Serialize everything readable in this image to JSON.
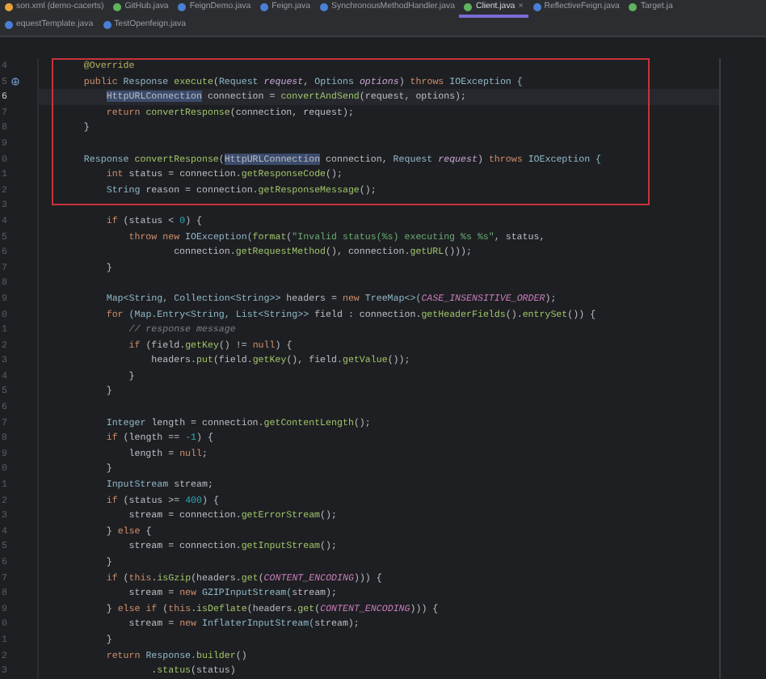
{
  "tabs_row_1": [
    {
      "label": "son.xml (demo-cacerts)",
      "color": "#e8a33c",
      "selected": false
    },
    {
      "label": "GitHub.java",
      "color": "#5fb35f",
      "selected": false
    },
    {
      "label": "FeignDemo.java",
      "color": "#4a7fd4",
      "selected": false
    },
    {
      "label": "Feign.java",
      "color": "#4a7fd4",
      "selected": false
    },
    {
      "label": "SynchronousMethodHandler.java",
      "color": "#4a7fd4",
      "selected": false
    },
    {
      "label": "Client.java",
      "color": "#5fb35f",
      "selected": true,
      "close": "×"
    },
    {
      "label": "ReflectiveFeign.java",
      "color": "#4a7fd4",
      "selected": false
    },
    {
      "label": "Target.ja",
      "color": "#5fb35f",
      "selected": false
    }
  ],
  "tabs_row_2": [
    {
      "label": "equestTemplate.java",
      "color": "#4a7fd4",
      "selected": false
    },
    {
      "label": "TestOpenfeign.java",
      "color": "#4a7fd4",
      "selected": false
    }
  ],
  "editor": {
    "lines": [
      {
        "num": "4",
        "current": false,
        "marker": false,
        "tokens": [
          {
            "text": "    @Override",
            "kind": "an"
          }
        ]
      },
      {
        "num": "5",
        "current": false,
        "marker": true,
        "tokens": [
          {
            "text": "    public",
            "kind": "kw"
          },
          {
            "text": " Response ",
            "kind": "ty"
          },
          {
            "text": "execute",
            "kind": "fn"
          },
          {
            "text": "(",
            "kind": "p"
          },
          {
            "text": "Request ",
            "kind": "ty"
          },
          {
            "text": "request",
            "kind": "pa"
          },
          {
            "text": ", ",
            "kind": "p"
          },
          {
            "text": "Options ",
            "kind": "ty"
          },
          {
            "text": "options",
            "kind": "pa"
          },
          {
            "text": ") ",
            "kind": "p"
          },
          {
            "text": "throws",
            "kind": "kw"
          },
          {
            "text": " IOException {",
            "kind": "ty"
          }
        ]
      },
      {
        "num": "6",
        "current": true,
        "marker": false,
        "tokens": [
          {
            "text": "        HttpURLConnection",
            "kind": "usage"
          },
          {
            "text": " connection = ",
            "kind": "p"
          },
          {
            "text": "convertAndSend",
            "kind": "fn"
          },
          {
            "text": "(request, options);",
            "kind": "p"
          }
        ]
      },
      {
        "num": "7",
        "current": false,
        "marker": false,
        "tokens": [
          {
            "text": "        return",
            "kind": "kw"
          },
          {
            "text": " convertResponse",
            "kind": "fn"
          },
          {
            "text": "(connection, request);",
            "kind": "p"
          }
        ]
      },
      {
        "num": "8",
        "current": false,
        "marker": false,
        "tokens": [
          {
            "text": "    }",
            "kind": "p"
          }
        ]
      },
      {
        "num": "9",
        "current": false,
        "marker": false
      },
      {
        "num": "0",
        "current": false,
        "marker": false,
        "tokens": [
          {
            "text": "    Response ",
            "kind": "ty"
          },
          {
            "text": "convertResponse",
            "kind": "fn"
          },
          {
            "text": "(",
            "kind": "p"
          },
          {
            "text": "HttpURLConnection",
            "kind": "usage"
          },
          {
            "text": " connection, ",
            "kind": "p"
          },
          {
            "text": "Request ",
            "kind": "ty"
          },
          {
            "text": "request",
            "kind": "pa"
          },
          {
            "text": ") ",
            "kind": "p"
          },
          {
            "text": "throws",
            "kind": "kw"
          },
          {
            "text": " IOException {",
            "kind": "ty"
          }
        ]
      },
      {
        "num": "1",
        "current": false,
        "marker": false,
        "tokens": [
          {
            "text": "        int",
            "kind": "kw"
          },
          {
            "text": " status = connection.",
            "kind": "p"
          },
          {
            "text": "getResponseCode",
            "kind": "fn"
          },
          {
            "text": "();",
            "kind": "p"
          }
        ]
      },
      {
        "num": "2",
        "current": false,
        "marker": false,
        "tokens": [
          {
            "text": "        String ",
            "kind": "ty"
          },
          {
            "text": "reason = connection.",
            "kind": "p"
          },
          {
            "text": "getResponseMessage",
            "kind": "fn"
          },
          {
            "text": "();",
            "kind": "p"
          }
        ]
      },
      {
        "num": "3",
        "current": false,
        "marker": false
      },
      {
        "num": "4",
        "current": false,
        "marker": false,
        "tokens": [
          {
            "text": "        if",
            "kind": "kw"
          },
          {
            "text": " (status < ",
            "kind": "p"
          },
          {
            "text": "0",
            "kind": "nu"
          },
          {
            "text": ") {",
            "kind": "p"
          }
        ]
      },
      {
        "num": "5",
        "current": false,
        "marker": false,
        "tokens": [
          {
            "text": "            throw new",
            "kind": "kw"
          },
          {
            "text": " IOException(",
            "kind": "ty"
          },
          {
            "text": "format",
            "kind": "fn"
          },
          {
            "text": "(",
            "kind": "p"
          },
          {
            "text": "\"Invalid status(%s) executing %s %s\"",
            "kind": "st"
          },
          {
            "text": ", status,",
            "kind": "p"
          }
        ]
      },
      {
        "num": "6",
        "current": false,
        "marker": false,
        "tokens": [
          {
            "text": "                    connection.",
            "kind": "p"
          },
          {
            "text": "getRequestMethod",
            "kind": "fn"
          },
          {
            "text": "(), connection.",
            "kind": "p"
          },
          {
            "text": "getURL",
            "kind": "fn"
          },
          {
            "text": "()));",
            "kind": "p"
          }
        ]
      },
      {
        "num": "7",
        "current": false,
        "marker": false,
        "tokens": [
          {
            "text": "        }",
            "kind": "p"
          }
        ]
      },
      {
        "num": "8",
        "current": false,
        "marker": false
      },
      {
        "num": "9",
        "current": false,
        "marker": false,
        "tokens": [
          {
            "text": "        Map<String, Collection<String>> ",
            "kind": "ty"
          },
          {
            "text": "headers = ",
            "kind": "p"
          },
          {
            "text": "new",
            "kind": "kw"
          },
          {
            "text": " TreeMap<>(",
            "kind": "ty"
          },
          {
            "text": "CASE_INSENSITIVE_ORDER",
            "kind": "cn"
          },
          {
            "text": ");",
            "kind": "p"
          }
        ]
      },
      {
        "num": "0",
        "current": false,
        "marker": false,
        "tokens": [
          {
            "text": "        for",
            "kind": "kw"
          },
          {
            "text": " (Map.Entry<String, List<String>> ",
            "kind": "ty"
          },
          {
            "text": "field : connection.",
            "kind": "p"
          },
          {
            "text": "getHeaderFields",
            "kind": "fn"
          },
          {
            "text": "().",
            "kind": "p"
          },
          {
            "text": "entrySet",
            "kind": "fn"
          },
          {
            "text": "()) {",
            "kind": "p"
          }
        ]
      },
      {
        "num": "1",
        "current": false,
        "marker": false,
        "tokens": [
          {
            "text": "            // response message",
            "kind": "cm"
          }
        ]
      },
      {
        "num": "2",
        "current": false,
        "marker": false,
        "tokens": [
          {
            "text": "            if",
            "kind": "kw"
          },
          {
            "text": " (field.",
            "kind": "p"
          },
          {
            "text": "getKey",
            "kind": "fn"
          },
          {
            "text": "() != ",
            "kind": "p"
          },
          {
            "text": "null",
            "kind": "kw"
          },
          {
            "text": ") {",
            "kind": "p"
          }
        ]
      },
      {
        "num": "3",
        "current": false,
        "marker": false,
        "tokens": [
          {
            "text": "                headers.",
            "kind": "p"
          },
          {
            "text": "put",
            "kind": "fn"
          },
          {
            "text": "(field.",
            "kind": "p"
          },
          {
            "text": "getKey",
            "kind": "fn"
          },
          {
            "text": "(), field.",
            "kind": "p"
          },
          {
            "text": "getValue",
            "kind": "fn"
          },
          {
            "text": "());",
            "kind": "p"
          }
        ]
      },
      {
        "num": "4",
        "current": false,
        "marker": false,
        "tokens": [
          {
            "text": "            }",
            "kind": "p"
          }
        ]
      },
      {
        "num": "5",
        "current": false,
        "marker": false,
        "tokens": [
          {
            "text": "        }",
            "kind": "p"
          }
        ]
      },
      {
        "num": "6",
        "current": false,
        "marker": false
      },
      {
        "num": "7",
        "current": false,
        "marker": false,
        "tokens": [
          {
            "text": "        Integer ",
            "kind": "ty"
          },
          {
            "text": "length = connection.",
            "kind": "p"
          },
          {
            "text": "getContentLength",
            "kind": "fn"
          },
          {
            "text": "();",
            "kind": "p"
          }
        ]
      },
      {
        "num": "8",
        "current": false,
        "marker": false,
        "tokens": [
          {
            "text": "        if",
            "kind": "kw"
          },
          {
            "text": " (length == ",
            "kind": "p"
          },
          {
            "text": "-1",
            "kind": "nu"
          },
          {
            "text": ") {",
            "kind": "p"
          }
        ]
      },
      {
        "num": "9",
        "current": false,
        "marker": false,
        "tokens": [
          {
            "text": "            length = ",
            "kind": "p"
          },
          {
            "text": "null",
            "kind": "kw"
          },
          {
            "text": ";",
            "kind": "p"
          }
        ]
      },
      {
        "num": "0",
        "current": false,
        "marker": false,
        "tokens": [
          {
            "text": "        }",
            "kind": "p"
          }
        ]
      },
      {
        "num": "1",
        "current": false,
        "marker": false,
        "tokens": [
          {
            "text": "        InputStream ",
            "kind": "ty"
          },
          {
            "text": "stream;",
            "kind": "p"
          }
        ]
      },
      {
        "num": "2",
        "current": false,
        "marker": false,
        "tokens": [
          {
            "text": "        if",
            "kind": "kw"
          },
          {
            "text": " (status >= ",
            "kind": "p"
          },
          {
            "text": "400",
            "kind": "nu"
          },
          {
            "text": ") {",
            "kind": "p"
          }
        ]
      },
      {
        "num": "3",
        "current": false,
        "marker": false,
        "tokens": [
          {
            "text": "            stream = connection.",
            "kind": "p"
          },
          {
            "text": "getErrorStream",
            "kind": "fn"
          },
          {
            "text": "();",
            "kind": "p"
          }
        ]
      },
      {
        "num": "4",
        "current": false,
        "marker": false,
        "tokens": [
          {
            "text": "        } ",
            "kind": "p"
          },
          {
            "text": "else",
            "kind": "kw"
          },
          {
            "text": " {",
            "kind": "p"
          }
        ]
      },
      {
        "num": "5",
        "current": false,
        "marker": false,
        "tokens": [
          {
            "text": "            stream = connection.",
            "kind": "p"
          },
          {
            "text": "getInputStream",
            "kind": "fn"
          },
          {
            "text": "();",
            "kind": "p"
          }
        ]
      },
      {
        "num": "6",
        "current": false,
        "marker": false,
        "tokens": [
          {
            "text": "        }",
            "kind": "p"
          }
        ]
      },
      {
        "num": "7",
        "current": false,
        "marker": false,
        "tokens": [
          {
            "text": "        if",
            "kind": "kw"
          },
          {
            "text": " (",
            "kind": "p"
          },
          {
            "text": "this",
            "kind": "kw"
          },
          {
            "text": ".",
            "kind": "p"
          },
          {
            "text": "isGzip",
            "kind": "fn"
          },
          {
            "text": "(headers.",
            "kind": "p"
          },
          {
            "text": "get",
            "kind": "fn"
          },
          {
            "text": "(",
            "kind": "p"
          },
          {
            "text": "CONTENT_ENCODING",
            "kind": "cn"
          },
          {
            "text": "))) {",
            "kind": "p"
          }
        ]
      },
      {
        "num": "8",
        "current": false,
        "marker": false,
        "tokens": [
          {
            "text": "            stream = ",
            "kind": "p"
          },
          {
            "text": "new",
            "kind": "kw"
          },
          {
            "text": " GZIPInputStream(",
            "kind": "ty"
          },
          {
            "text": "stream);",
            "kind": "p"
          }
        ]
      },
      {
        "num": "9",
        "current": false,
        "marker": false,
        "tokens": [
          {
            "text": "        } ",
            "kind": "p"
          },
          {
            "text": "else if",
            "kind": "kw"
          },
          {
            "text": " (",
            "kind": "p"
          },
          {
            "text": "this",
            "kind": "kw"
          },
          {
            "text": ".",
            "kind": "p"
          },
          {
            "text": "isDeflate",
            "kind": "fn"
          },
          {
            "text": "(headers.",
            "kind": "p"
          },
          {
            "text": "get",
            "kind": "fn"
          },
          {
            "text": "(",
            "kind": "p"
          },
          {
            "text": "CONTENT_ENCODING",
            "kind": "cn"
          },
          {
            "text": "))) {",
            "kind": "p"
          }
        ]
      },
      {
        "num": "0",
        "current": false,
        "marker": false,
        "tokens": [
          {
            "text": "            stream = ",
            "kind": "p"
          },
          {
            "text": "new",
            "kind": "kw"
          },
          {
            "text": " InflaterInputStream(",
            "kind": "ty"
          },
          {
            "text": "stream);",
            "kind": "p"
          }
        ]
      },
      {
        "num": "1",
        "current": false,
        "marker": false,
        "tokens": [
          {
            "text": "        }",
            "kind": "p"
          }
        ]
      },
      {
        "num": "2",
        "current": false,
        "marker": false,
        "tokens": [
          {
            "text": "        return",
            "kind": "kw"
          },
          {
            "text": " Response.",
            "kind": "ty"
          },
          {
            "text": "builder",
            "kind": "fn"
          },
          {
            "text": "()",
            "kind": "p"
          }
        ]
      },
      {
        "num": "3",
        "current": false,
        "marker": false,
        "tokens": [
          {
            "text": "                .",
            "kind": "p"
          },
          {
            "text": "status",
            "kind": "fn"
          },
          {
            "text": "(status)",
            "kind": "p"
          }
        ]
      }
    ]
  }
}
